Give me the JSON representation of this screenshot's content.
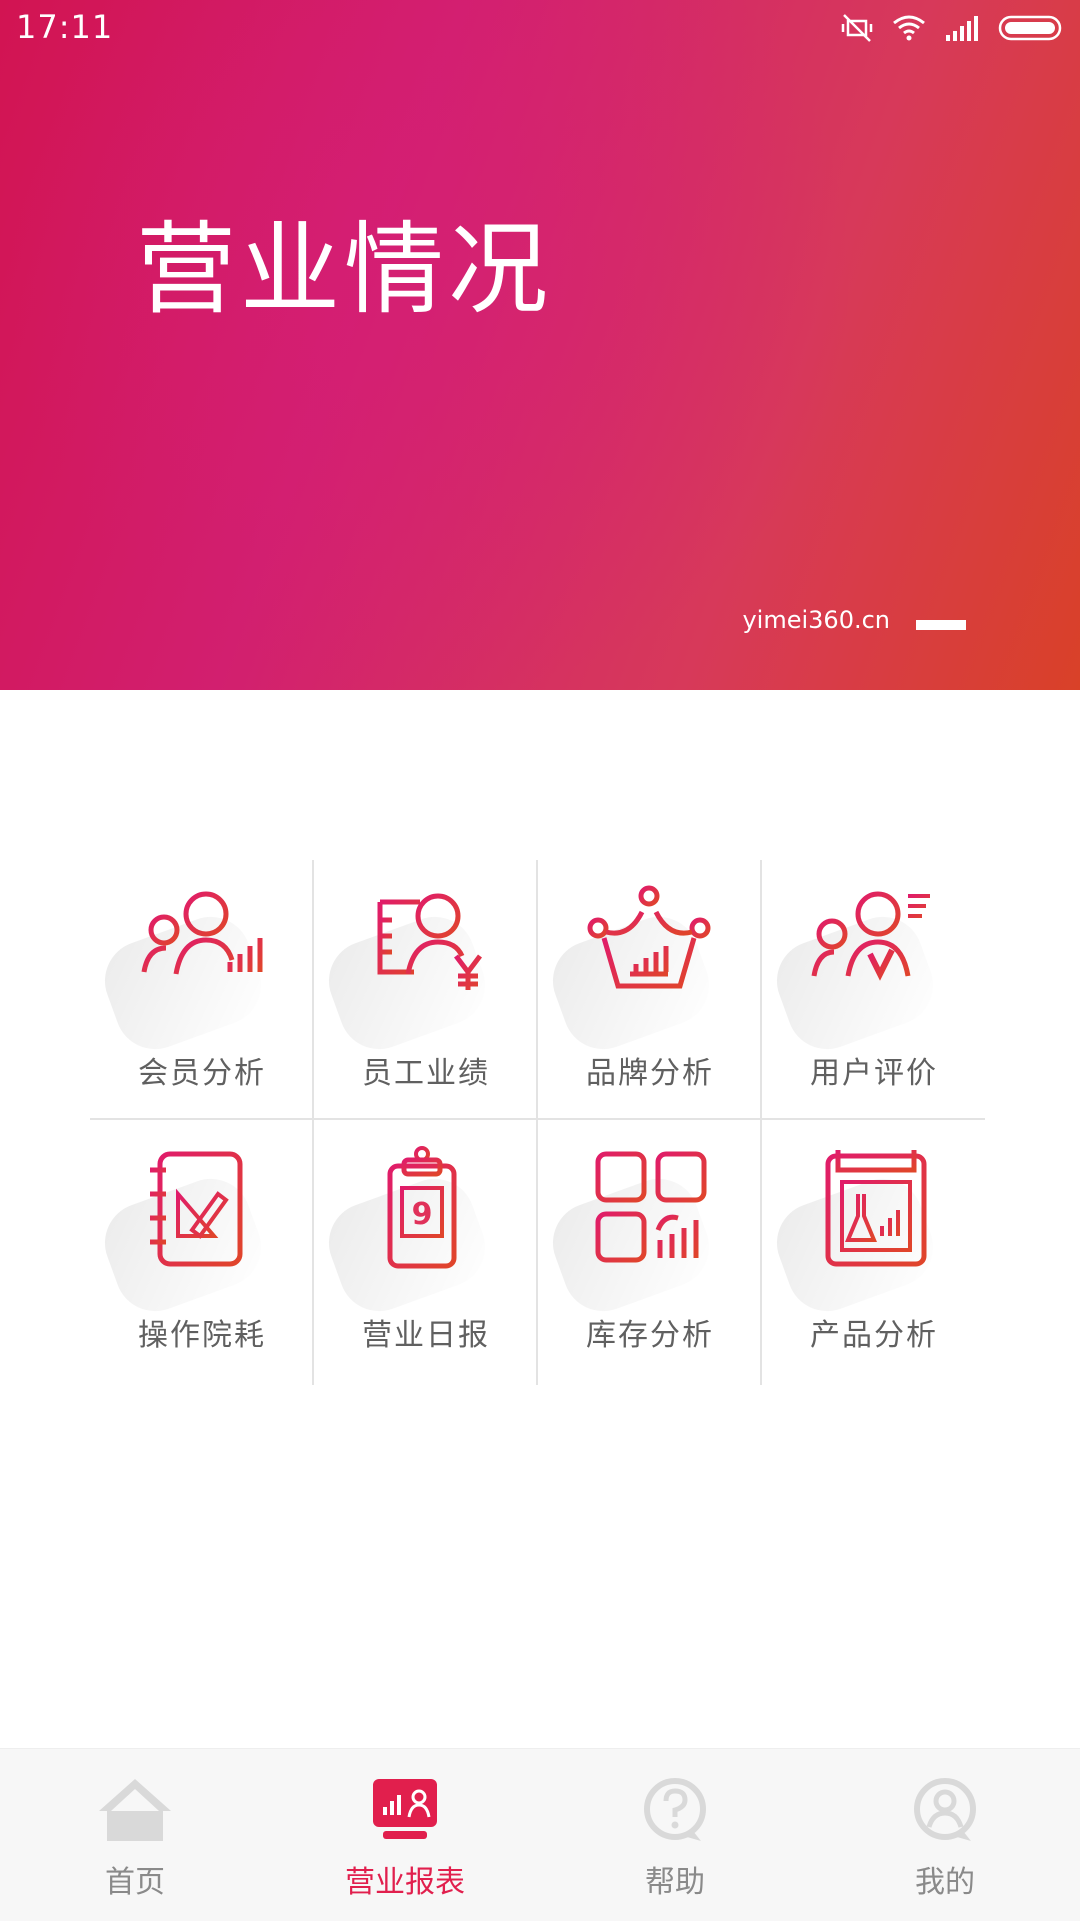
{
  "status_bar": {
    "time": "17:11"
  },
  "banner": {
    "title": "营业情况",
    "url": "yimei360.cn"
  },
  "grid": {
    "items": [
      {
        "label": "会员分析",
        "icon": "members-analysis-icon"
      },
      {
        "label": "员工业绩",
        "icon": "employee-performance-icon"
      },
      {
        "label": "品牌分析",
        "icon": "brand-analysis-icon"
      },
      {
        "label": "用户评价",
        "icon": "user-review-icon"
      },
      {
        "label": "操作院耗",
        "icon": "operation-consumption-icon"
      },
      {
        "label": "营业日报",
        "icon": "daily-report-icon"
      },
      {
        "label": "库存分析",
        "icon": "inventory-analysis-icon"
      },
      {
        "label": "产品分析",
        "icon": "product-analysis-icon"
      }
    ]
  },
  "bottom_nav": {
    "items": [
      {
        "label": "首页",
        "icon": "home-icon",
        "active": false
      },
      {
        "label": "营业报表",
        "icon": "report-icon",
        "active": true
      },
      {
        "label": "帮助",
        "icon": "help-icon",
        "active": false
      },
      {
        "label": "我的",
        "icon": "profile-icon",
        "active": false
      }
    ]
  },
  "colors": {
    "accent": "#e11f4d",
    "banner_start": "#d21452",
    "banner_end": "#d94128",
    "inactive_nav": "#8a8a8a"
  }
}
